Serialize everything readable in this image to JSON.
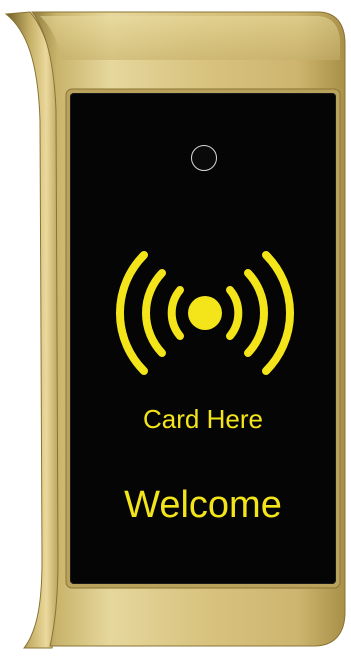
{
  "lock": {
    "card_prompt": "Card Here",
    "welcome_message": "Welcome"
  },
  "colors": {
    "display_text": "#f3e51a",
    "display_background": "#050505",
    "housing_gold": "#d9c47c"
  },
  "icons": {
    "rfid_symbol": "rfid-wave-icon",
    "sensor": "sensor-ring-icon"
  }
}
